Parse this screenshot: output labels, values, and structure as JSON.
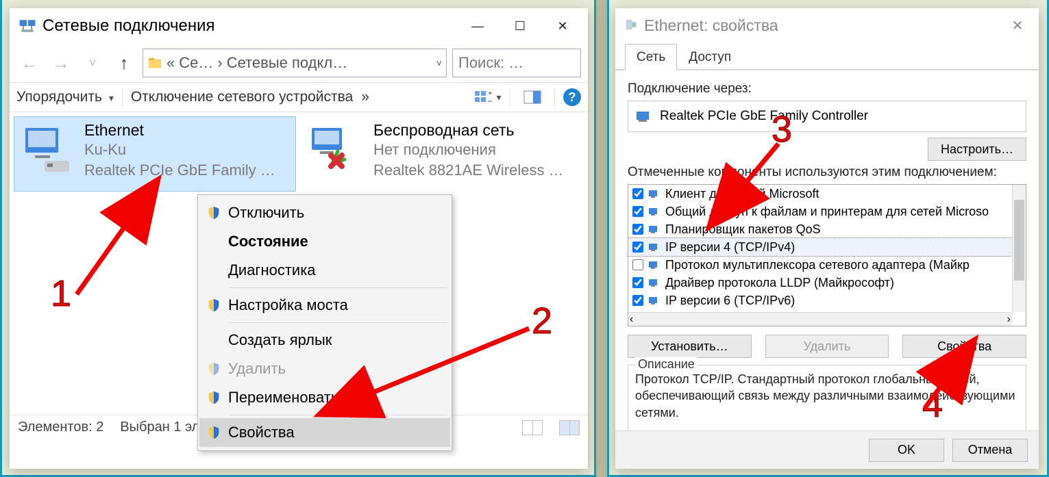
{
  "left": {
    "title": "Сетевые подключения",
    "breadcrumb": {
      "a": "Се…",
      "b": "Сетевые подкл…"
    },
    "search_placeholder": "Поиск: …",
    "toolbar": {
      "sort": "Упорядочить",
      "disable": "Отключение сетевого устройства",
      "more": "»"
    },
    "items": {
      "ethernet": {
        "name": "Ethernet",
        "status": "Ku-Ku",
        "device": "Realtek PCIe GbE Family …"
      },
      "wifi": {
        "name": "Беспроводная сеть",
        "status": "Нет подключения",
        "device": "Realtek 8821AE Wireless …"
      }
    },
    "status": {
      "count": "Элементов: 2",
      "selected": "Выбран 1 элемент"
    },
    "ctx": {
      "disable": "Отключить",
      "state": "Состояние",
      "diag": "Диагностика",
      "bridge": "Настройка моста",
      "shortcut": "Создать ярлык",
      "delete": "Удалить",
      "rename": "Переименовать",
      "props": "Свойства"
    }
  },
  "right": {
    "title": "Ethernet: свойства",
    "tabs": {
      "net": "Сеть",
      "share": "Доступ"
    },
    "connect_via_label": "Подключение через:",
    "adapter": "Realtek PCIe GbE Family Controller",
    "configure": "Настроить…",
    "components_label": "Отмеченные компоненты используются этим подключением:",
    "components": [
      {
        "checked": true,
        "label": "Клиент для сетей Microsoft"
      },
      {
        "checked": true,
        "label": "Общий доступ к файлам и принтерам для сетей Microso"
      },
      {
        "checked": true,
        "label": "Планировщик пакетов QoS"
      },
      {
        "checked": true,
        "label": "IP версии 4 (TCP/IPv4)"
      },
      {
        "checked": false,
        "label": "Протокол мультиплексора сетевого адаптера (Майкр"
      },
      {
        "checked": true,
        "label": "Драйвер протокола LLDP (Майкрософт)"
      },
      {
        "checked": true,
        "label": "IP версии 6 (TCP/IPv6)"
      }
    ],
    "buttons": {
      "install": "Установить…",
      "remove": "Удалить",
      "props": "Свойства"
    },
    "desc_legend": "Описание",
    "desc_text": "Протокол TCP/IP. Стандартный протокол глобальных сетей, обеспечивающий связь между различными взаимодействующими сетями.",
    "ok": "OK",
    "cancel": "Отмена"
  },
  "annotations": {
    "n1": "1",
    "n2": "2",
    "n3": "3",
    "n4": "4"
  }
}
